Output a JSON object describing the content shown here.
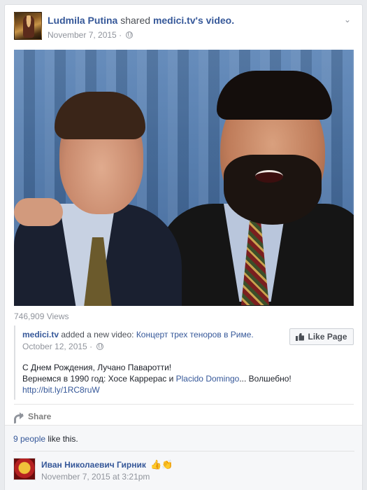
{
  "post": {
    "author": "Ludmila Putina",
    "shared_word": "shared",
    "source_page": "medici.tv",
    "source_suffix": "'s video.",
    "date": "November 7, 2015",
    "separator": "·",
    "privacy_icon": "globe-icon",
    "options_icon": "chevron-down-icon"
  },
  "video": {
    "views": "746,909 Views"
  },
  "shared": {
    "page": "medici.tv",
    "action": "added a new video:",
    "video_title": "Концерт трех теноров в Риме.",
    "date": "October 12, 2015",
    "separator": "·",
    "like_page_label": "Like Page",
    "line1": "С Днем Рождения, Лучано Паваротти!",
    "line2_before": "Вернемся в 1990 год: Хосе Каррерас и ",
    "line2_link": "Placido Domingo",
    "line2_after": "... Волшебно!",
    "url": "http://bit.ly/1RC8ruW"
  },
  "actions": {
    "share_label": "Share"
  },
  "likes": {
    "count_link": "9 people",
    "suffix": " like this."
  },
  "comment": {
    "author": "Иван Николаевич Гирник",
    "emoji": "👍👏",
    "time": "November 7, 2015 at 3:21pm"
  },
  "colors": {
    "link": "#365899",
    "muted": "#90949c",
    "background": "#e9ebee"
  }
}
